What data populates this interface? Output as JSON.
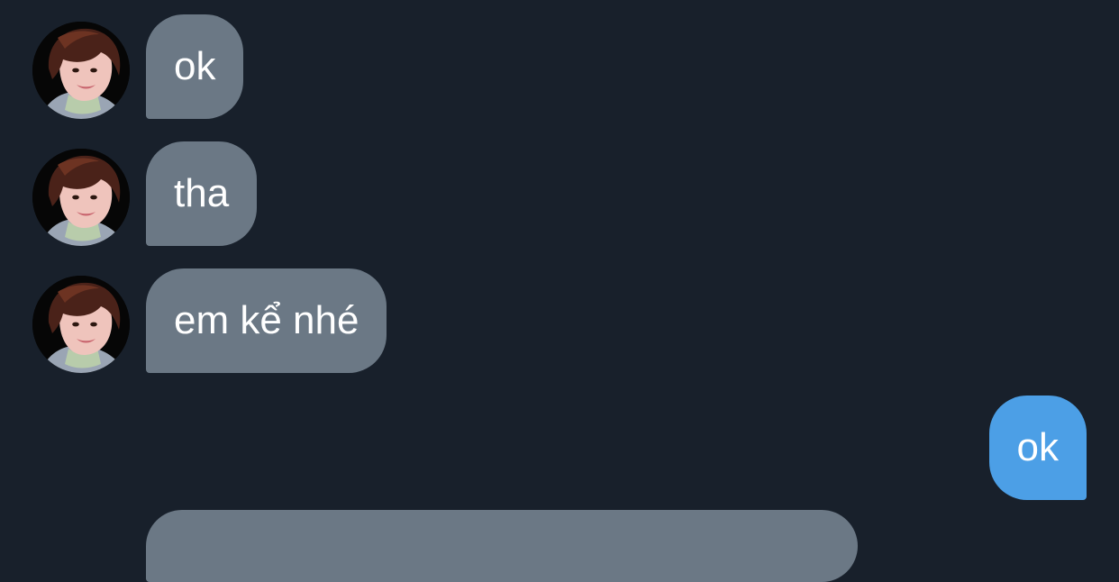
{
  "conversation": {
    "messages": [
      {
        "sender": "other",
        "text": "ok"
      },
      {
        "sender": "other",
        "text": "tha"
      },
      {
        "sender": "other",
        "text": "em kể nhé"
      },
      {
        "sender": "me",
        "text": "ok"
      }
    ]
  },
  "colors": {
    "background": "#18202b",
    "incoming_bubble": "#6b7885",
    "outgoing_bubble": "#4c9fe6",
    "text": "#ffffff"
  }
}
